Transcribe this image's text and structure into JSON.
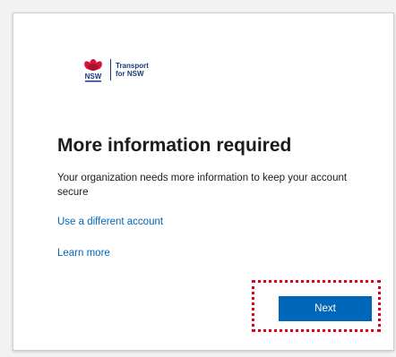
{
  "logo": {
    "abbrev": "NSW",
    "name_line1": "Transport",
    "name_line2": "for NSW"
  },
  "dialog": {
    "title": "More information required",
    "description": "Your organization needs more information to keep your account secure",
    "link_different_account": "Use a different account",
    "link_learn_more": "Learn more",
    "next_label": "Next"
  },
  "colors": {
    "accent": "#0067b8",
    "highlight": "#e0001a",
    "nsw_red": "#d7153a",
    "nsw_navy": "#1a3a7a"
  }
}
